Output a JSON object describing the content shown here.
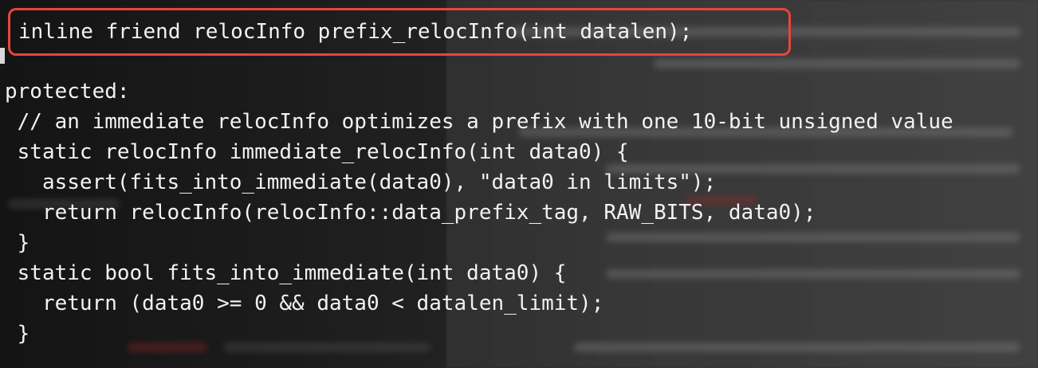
{
  "code": {
    "highlighted_line": "inline friend relocInfo prefix_relocInfo(int datalen);",
    "lines": [
      "protected:",
      " // an immediate relocInfo optimizes a prefix with one 10-bit unsigned value",
      " static relocInfo immediate_relocInfo(int data0) {",
      "   assert(fits_into_immediate(data0), \"data0 in limits\");",
      "   return relocInfo(relocInfo::data_prefix_tag, RAW_BITS, data0);",
      " }",
      " static bool fits_into_immediate(int data0) {",
      "   return (data0 >= 0 && data0 < datalen_limit);",
      " }"
    ]
  },
  "colors": {
    "highlight_border": "#e8453c",
    "text": "#f2f2f2"
  }
}
